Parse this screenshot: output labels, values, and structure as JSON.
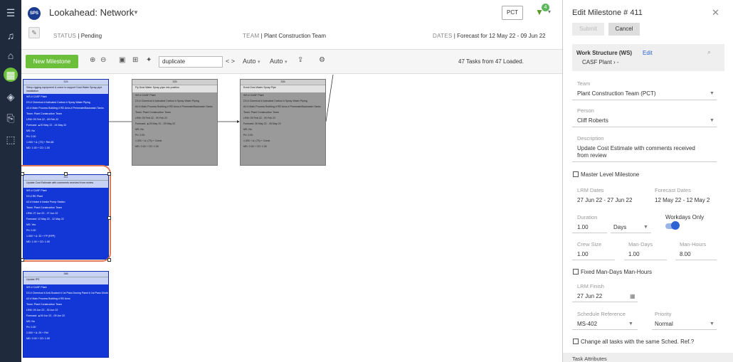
{
  "rail": {
    "icons": [
      "menu-icon",
      "bell-icon",
      "home-icon",
      "network-icon",
      "layers-icon",
      "export-icon",
      "chart-icon"
    ]
  },
  "header": {
    "logo": "SPS",
    "title": "Lookahead: Network",
    "pct": "PCT",
    "filter_count": "4",
    "status_label": "STATUS",
    "status_value": "Pending",
    "team_label": "TEAM",
    "team_value": "Plant Construction Team",
    "dates_label": "DATES",
    "dates_value": "Forecast for 12 May 22 - 09 Jun 22"
  },
  "toolbar": {
    "new_milestone": "New Milestone",
    "search_value": "duplicate",
    "nav": "< >",
    "auto1": "Auto",
    "auto2": "Auto",
    "tasks_status": "47 Tasks from 47 Loaded."
  },
  "cards": [
    {
      "id": "324",
      "sub": "Setup rigging equipment & crane to support Dust Water Spray pipe installation",
      "lines": [
        "WS # CASF Plant",
        "D3 # Chemical # Activated Carbon # Spray Water Piping",
        "A3 # Main Process Building # RD Area # Permeate/Backwash Tanks",
        "Team: Plant Construction Team",
        "LRM: 09 Feb 22 - 09 Feb 22",
        "Forecast: ▲20 May 22 - 24 May 22",
        "MS: No",
        "Pri: 2.00",
        "1.000 + Δ: (73) + Rel-68",
        "MD: 1.00 + CD: 1.00"
      ]
    },
    {
      "id": "411",
      "sub": "Update Cost Estimate with comments received from review",
      "lines": [
        "WS # CASF Plant",
        "D3 # RD Plant",
        "A3 # Intake # Intake Pump Station",
        "Team: Plant Construction Team",
        "LRM: 27 Jun 22 - 27 Jun 22",
        "Forecast: 12 May 22 - 12 May 22",
        "MS: Yes",
        "Pri: 2.00",
        "1.000 + Δ: 33 + FP (RFP)",
        "MD: 1.00 + CD: 1.00"
      ]
    },
    {
      "id": "388",
      "sub": "Update IPS",
      "lines": [
        "WS # CASF Plant",
        "D3 # Chemical # Anti-Scalant # 1st Pass Dosing Panel # 1st Pass Dilution Panel",
        "A3 # Main Process Building # RD Area",
        "Team: Plant Construction Team",
        "LRM: 09 Jun 22 - 30 Jun 22",
        "Forecast: ▲09 Jun 22 - 09 Jun 22",
        "MS: No",
        "Pri: 2.00",
        "2.000 + Δ: 29 + Rel",
        "MD: 2.00 + CD: 1.00"
      ]
    },
    {
      "id": "325",
      "sub": "Fly Dust Water Spray pipe into position",
      "lines": [
        "WS # CASF Plant",
        "D3 # Chemical # Activated Carbon # Spray Water Piping",
        "A3 # Main Process Building # RD Area # Permeate/Backwash Tanks",
        "Team: Plant Construction Team",
        "LRM: 09 Feb 22 - 09 Feb 22",
        "Forecast: ▲25 May 22 - 25 May 22",
        "MS: No",
        "Pri: 2.00",
        "1.000 + Δ: (73) + Const",
        "MD: 2.00 + CD: 1.00"
      ]
    },
    {
      "id": "326",
      "sub": "Erect Dust Water Spray Pipe",
      "lines": [
        "WS # CASF Plant",
        "D3 # Chemical # Activated Carbon # Spray Water Piping",
        "A3 # Main Process Building # RD Area # Permeate/Backwash Tanks",
        "Team: Plant Construction Team",
        "LRM: 09 Feb 22 - 09 Feb 22",
        "Forecast: 26 May 22 - 26 May 22",
        "MS: No",
        "Pri: 2.00",
        "1.000 + Δ: (73) + Const",
        "MD: 2.00 + CD: 1.00"
      ]
    }
  ],
  "panel": {
    "title": "Edit Milestone # 411",
    "submit": "Submit",
    "cancel": "Cancel",
    "ws_label": "Work Structure (WS)",
    "ws_edit": "Edit",
    "ws_value": "CASF Plant",
    "ws_sep": "› -",
    "team_label": "Team",
    "team_value": "Plant Construction Team (PCT)",
    "person_label": "Person",
    "person_value": "Cliff Roberts",
    "desc_label": "Description",
    "desc_value_1": "Update Cost Estimate with comments received",
    "desc_value_2": "from review",
    "master_label": "Master Level Milestone",
    "lrm_dates_label": "LRM Dates",
    "lrm_dates_value": "27 Jun 22 - 27 Jun 22",
    "forecast_dates_label": "Forecast Dates",
    "forecast_dates_value": "12 May 22 - 12 May 2",
    "duration_label": "Duration",
    "duration_value": "1.00",
    "duration_unit": "Days",
    "workdays_label": "Workdays Only",
    "crew_label": "Crew Size",
    "crew_value": "1.00",
    "mandays_label": "Man-Days",
    "mandays_value": "1.00",
    "manhours_label": "Man-Hours",
    "manhours_value": "8.00",
    "fixed_label": "Fixed Man-Days Man-Hours",
    "lrm_finish_label": "LRM Finish",
    "lrm_finish_value": "27 Jun 22",
    "sched_ref_label": "Schedule Reference",
    "sched_ref_value": "MS-402",
    "priority_label": "Priority",
    "priority_value": "Normal",
    "change_all_label": "Change all tasks with the same Sched. Ref.?",
    "task_attributes": "Task Attributes"
  }
}
